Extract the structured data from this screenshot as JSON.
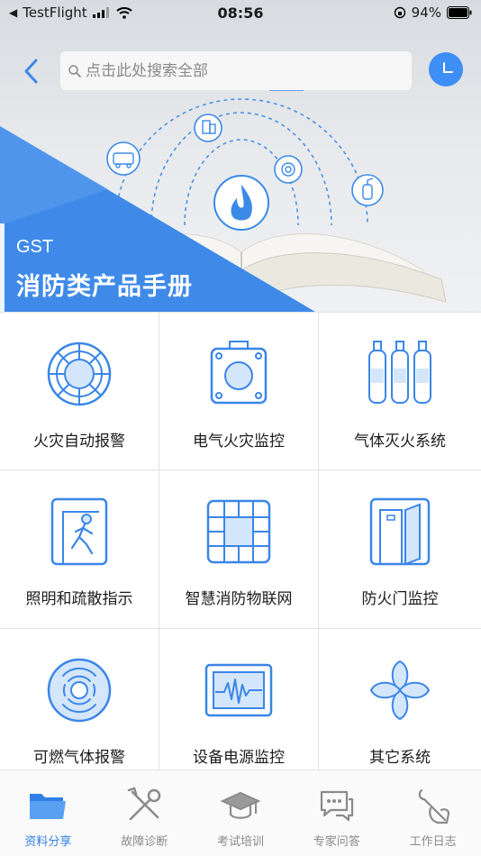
{
  "status_bar": {
    "carrier": "TestFlight",
    "time": "08:56",
    "battery": "94%"
  },
  "header": {
    "search_placeholder": "点击此处搜索全部"
  },
  "banner": {
    "subtitle": "GST",
    "title": "消防类产品手册"
  },
  "grid": [
    {
      "label": "火灾自动报警",
      "icon": "fire-alarm-detector-icon"
    },
    {
      "label": "电气火灾监控",
      "icon": "electrical-monitor-icon"
    },
    {
      "label": "气体灭火系统",
      "icon": "gas-cylinders-icon"
    },
    {
      "label": "照明和疏散指示",
      "icon": "evacuation-sign-icon"
    },
    {
      "label": "智慧消防物联网",
      "icon": "iot-chip-icon"
    },
    {
      "label": "防火门监控",
      "icon": "fire-door-icon"
    },
    {
      "label": "可燃气体报警",
      "icon": "gas-detector-icon"
    },
    {
      "label": "设备电源监控",
      "icon": "power-monitor-icon"
    },
    {
      "label": "其它系统",
      "icon": "other-systems-icon"
    }
  ],
  "tabbar": [
    {
      "label": "资料分享",
      "icon": "folder-icon",
      "active": true
    },
    {
      "label": "故障诊断",
      "icon": "tools-icon",
      "active": false
    },
    {
      "label": "考试培训",
      "icon": "graduation-cap-icon",
      "active": false
    },
    {
      "label": "专家问答",
      "icon": "chat-bubbles-icon",
      "active": false
    },
    {
      "label": "工作日志",
      "icon": "wrench-hand-icon",
      "active": false
    }
  ],
  "colors": {
    "accent": "#3d8ef5",
    "icon_stroke": "#3a86e8",
    "icon_fill": "#d4e6fb",
    "banner_triangle": "#3f8ae8",
    "active_tab": "#2f7fe6",
    "inactive_tab": "#8a8a8a"
  }
}
